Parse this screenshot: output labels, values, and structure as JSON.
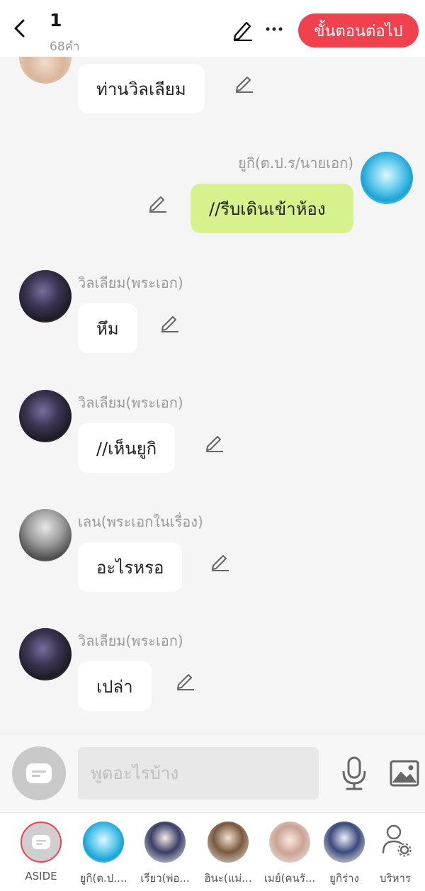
{
  "header": {
    "title": "1",
    "word_count": "68คำ",
    "next_label": "ขั้นตอนต่อไป",
    "accent_color": "#f0414f"
  },
  "messages": [
    {
      "sender": "",
      "text": "ท่านวิลเลียม",
      "side": "left",
      "avatar": "peach-girl-avatar"
    },
    {
      "sender": "ยูกิ(ต.ป.ร/นายเอก)",
      "text": "//รีบเดินเข้าห้อง",
      "side": "right",
      "avatar": "blue-hair-avatar"
    },
    {
      "sender": "วิลเลียม(พระเอก)",
      "text": "หึม",
      "side": "left",
      "avatar": "dark-hair-avatar"
    },
    {
      "sender": "วิลเลียม(พระเอก)",
      "text": "//เห็นยูกิ",
      "side": "left",
      "avatar": "dark-hair-avatar"
    },
    {
      "sender": "เลน(พระเอกในเรื่อง)",
      "text": "อะไรหรอ",
      "side": "left",
      "avatar": "grey-hair-avatar"
    },
    {
      "sender": "วิลเลียม(พระเอก)",
      "text": "เปล่า",
      "side": "left",
      "avatar": "dark-hair-avatar"
    }
  ],
  "composer": {
    "placeholder": "พูดอะไรบ้าง"
  },
  "characters": [
    {
      "label": "ASIDE"
    },
    {
      "label": "ยูกิ(ต.ป...."
    },
    {
      "label": "เรียว(พ่อ..."
    },
    {
      "label": "ฮินะ(แม่..."
    },
    {
      "label": "เมย์(คนรั..."
    },
    {
      "label": "ยูกิร่าง"
    },
    {
      "label": "บริหาร"
    }
  ],
  "colors": {
    "my_bubble": "#d7f18d",
    "other_bubble": "#ffffff",
    "background": "#f5f5f5"
  }
}
